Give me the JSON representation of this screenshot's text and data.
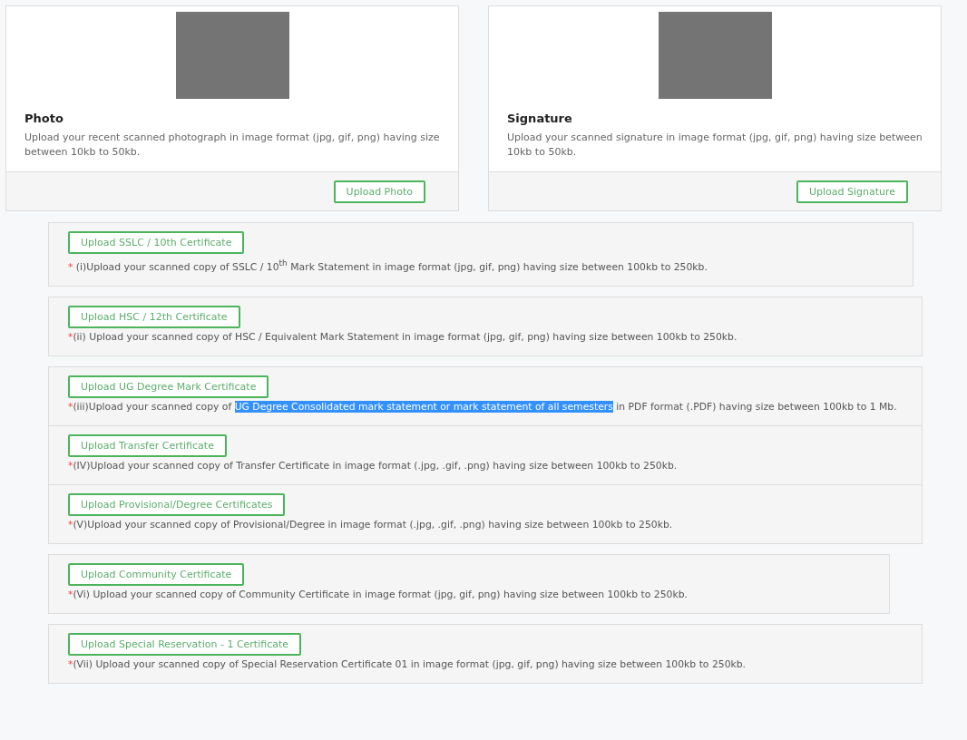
{
  "uploads": [
    {
      "title": "Photo",
      "description": "Upload your recent scanned photograph in image format (jpg, gif, png) having size between 10kb to 50kb.",
      "button": "Upload Photo"
    },
    {
      "title": "Signature",
      "description": "Upload your scanned signature in image format (jpg, gif, png) having size between 10kb to 50kb.",
      "button": "Upload Signature"
    }
  ],
  "groups": [
    {
      "items": [
        {
          "button": "Upload SSLC / 10th Certificate",
          "marker": "*",
          "note": [
            {
              "text": " (i)Upload your scanned copy of SSLC / 10$^{th}$ Mark Statement in image format (jpg, gif, png) having size between 100kb to 250kb.",
              "selected": false
            }
          ]
        }
      ]
    },
    {
      "items": [
        {
          "button": "Upload HSC / 12th Certificate",
          "marker": "*",
          "note": [
            {
              "text": "(ii) Upload your scanned copy of HSC / Equivalent Mark Statement in image format (jpg, gif, png) having size between 100kb to 250kb.",
              "selected": false
            }
          ]
        }
      ]
    },
    {
      "items": [
        {
          "button": "Upload UG Degree Mark Certificate",
          "marker": "*",
          "note": [
            {
              "text": "(iii)Upload your scanned copy of ",
              "selected": false
            },
            {
              "text": "UG Degree Consolidated mark statement or mark statement of all semesters",
              "selected": true
            },
            {
              "text": " in PDF format (.PDF) having size between 100kb to 1 Mb.",
              "selected": false
            }
          ]
        },
        {
          "button": "Upload Transfer Certificate",
          "marker": "*",
          "note": [
            {
              "text": "(IV)Upload your scanned copy of Transfer Certificate in image format (.jpg, .gif, .png) having size between 100kb to 250kb.",
              "selected": false
            }
          ]
        },
        {
          "button": "Upload Provisional/Degree Certificates",
          "marker": "*",
          "note": [
            {
              "text": "(V)Upload your scanned copy of Provisional/Degree in image format (.jpg, .gif, .png) having size between 100kb to 250kb.",
              "selected": false
            }
          ]
        }
      ]
    },
    {
      "items": [
        {
          "button": "Upload Community Certificate",
          "marker": "*",
          "note": [
            {
              "text": "(Vi) Upload your scanned copy of Community Certificate in image format (jpg, gif, png) having size between 100kb to 250kb.",
              "selected": false
            }
          ]
        }
      ]
    },
    {
      "items": [
        {
          "button": "Upload Special Reservation - 1 Certificate",
          "marker": "*",
          "note": [
            {
              "text": "(Vii) Upload your scanned copy of Special Reservation Certificate 01 in image format (jpg, gif, png) having size between 100kb to 250kb.",
              "selected": false
            }
          ]
        }
      ]
    }
  ]
}
